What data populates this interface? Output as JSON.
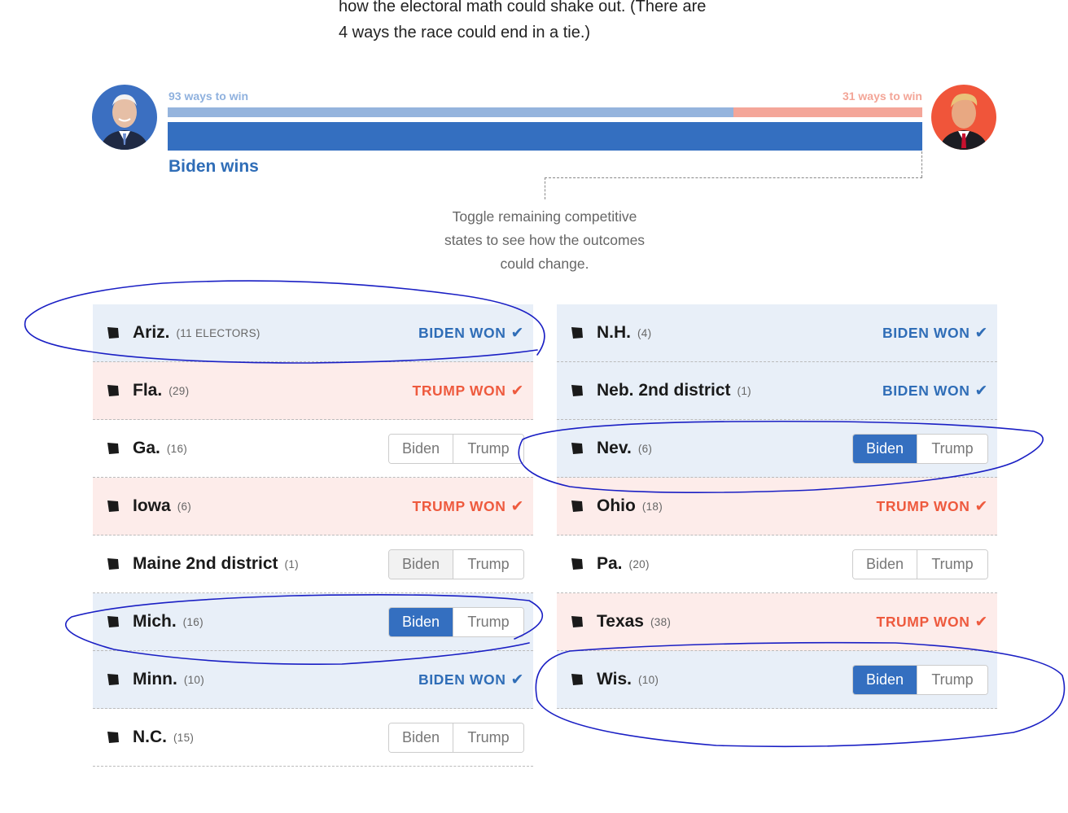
{
  "intro": {
    "line1": "how the electoral math could shake out. (There are",
    "line2": "4 ways the race could end in a tie.)"
  },
  "bar": {
    "biden_ways": "93 ways to win",
    "trump_ways": "31 ways to win",
    "biden_share": 0.75,
    "result": "Biden wins"
  },
  "note": {
    "line1": "Toggle remaining competitive",
    "line2": "states to see how the outcomes",
    "line3": "could change."
  },
  "labels": {
    "biden_won": "BIDEN WON",
    "trump_won": "TRUMP WON",
    "biden": "Biden",
    "trump": "Trump"
  },
  "colors": {
    "biden": "#346fc0",
    "trump": "#ee5a3e",
    "biden_row": "#e8eff8",
    "trump_row": "#fdecea"
  },
  "states_left": [
    {
      "name": "Ariz.",
      "electors": "(11 ELECTORS)",
      "status": "biden_won"
    },
    {
      "name": "Fla.",
      "electors": "(29)",
      "status": "trump_won"
    },
    {
      "name": "Ga.",
      "electors": "(16)",
      "status": "toggle",
      "selected": "none"
    },
    {
      "name": "Iowa",
      "electors": "(6)",
      "status": "trump_won"
    },
    {
      "name": "Maine 2nd district",
      "electors": "(1)",
      "status": "toggle",
      "selected": "none"
    },
    {
      "name": "Mich.",
      "electors": "(16)",
      "status": "toggle",
      "selected": "biden"
    },
    {
      "name": "Minn.",
      "electors": "(10)",
      "status": "biden_won"
    },
    {
      "name": "N.C.",
      "electors": "(15)",
      "status": "toggle",
      "selected": "none"
    }
  ],
  "states_right": [
    {
      "name": "N.H.",
      "electors": "(4)",
      "status": "biden_won"
    },
    {
      "name": "Neb. 2nd district",
      "electors": "(1)",
      "status": "biden_won"
    },
    {
      "name": "Nev.",
      "electors": "(6)",
      "status": "toggle",
      "selected": "biden"
    },
    {
      "name": "Ohio",
      "electors": "(18)",
      "status": "trump_won"
    },
    {
      "name": "Pa.",
      "electors": "(20)",
      "status": "toggle",
      "selected": "none"
    },
    {
      "name": "Texas",
      "electors": "(38)",
      "status": "trump_won"
    },
    {
      "name": "Wis.",
      "electors": "(10)",
      "status": "toggle",
      "selected": "biden"
    }
  ]
}
